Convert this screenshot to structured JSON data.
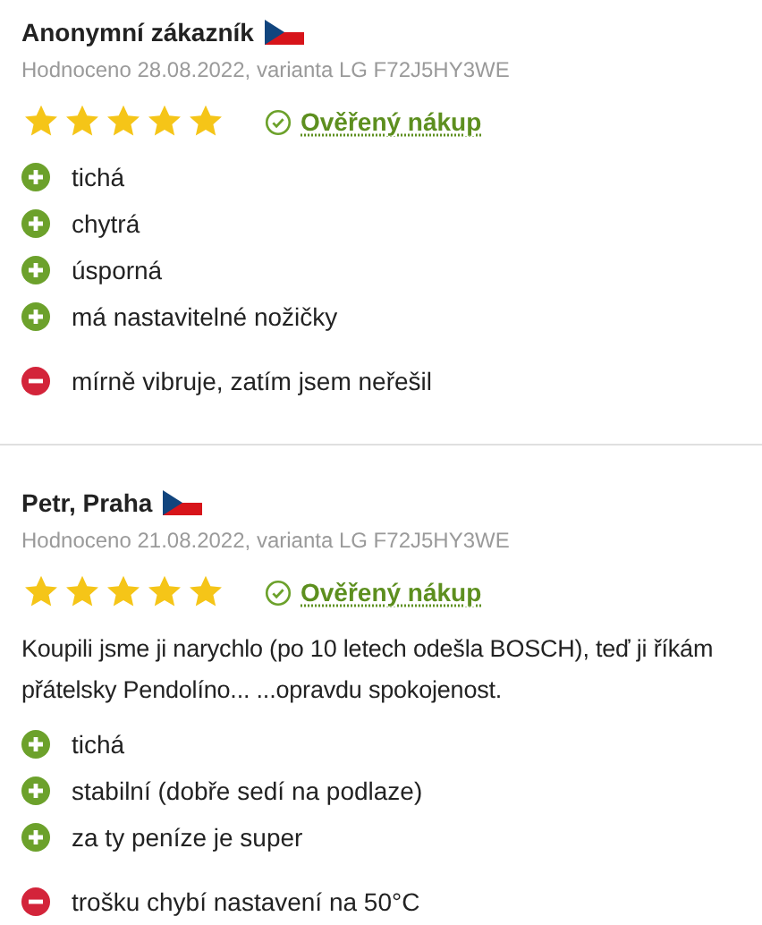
{
  "reviews": [
    {
      "author": "Anonymní zákazník",
      "meta": "Hodnoceno 28.08.2022, varianta LG F72J5HY3WE",
      "stars": 5,
      "verified": "Ověřený nákup",
      "pros": [
        "tichá",
        "chytrá",
        "úsporná",
        "má nastavitelné nožičky"
      ],
      "cons": [
        "mírně vibruje, zatím jsem neřešil"
      ]
    },
    {
      "author": "Petr, Praha",
      "meta": "Hodnoceno 21.08.2022, varianta LG F72J5HY3WE",
      "stars": 5,
      "verified": "Ověřený nákup",
      "text": "Koupili jsme ji narychlo (po 10 letech odešla BOSCH), teď ji říkám přátelsky Pendolíno... ...opravdu spokojenost.",
      "pros": [
        "tichá",
        "stabilní (dobře sedí na podlaze)",
        "za ty peníze je super"
      ],
      "cons": [
        "trošku chybí nastavení na 50°C"
      ]
    }
  ]
}
